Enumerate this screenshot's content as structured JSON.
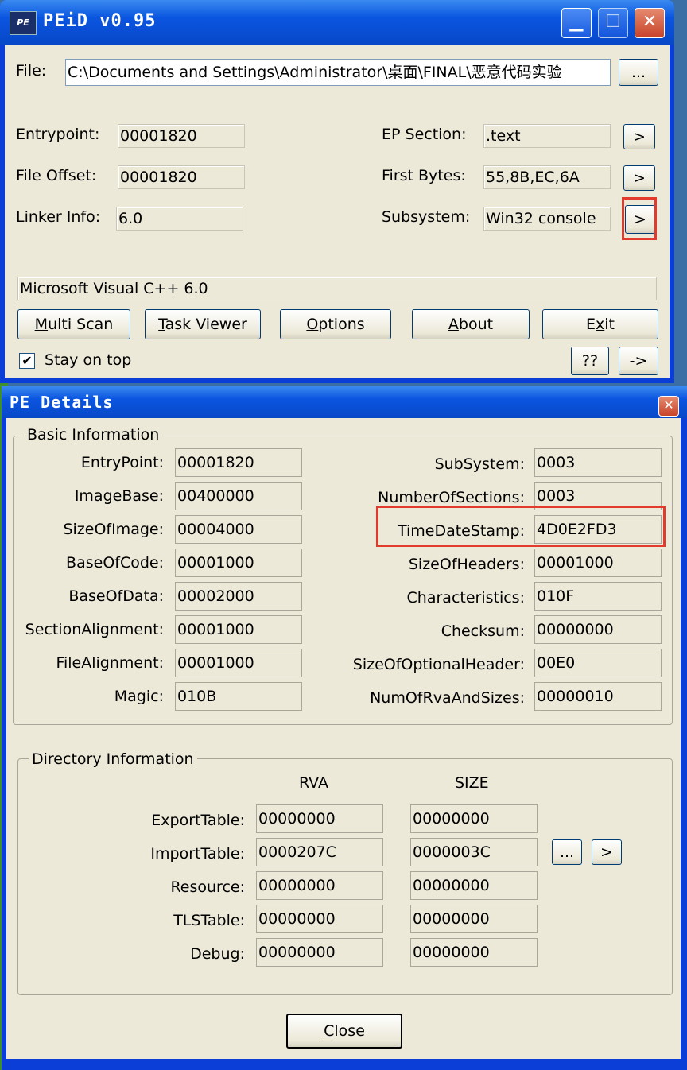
{
  "main": {
    "title": "PEiD v0.95",
    "icon_text": "PE",
    "file_label": "File:",
    "file_value": "C:\\Documents and Settings\\Administrator\\桌面\\FINAL\\恶意代码实验",
    "browse_label": "...",
    "entrypoint_label": "Entrypoint:",
    "entrypoint_value": "00001820",
    "fileoffset_label": "File Offset:",
    "fileoffset_value": "00001820",
    "linker_label": "Linker Info:",
    "linker_value": "6.0",
    "epsection_label": "EP Section:",
    "epsection_value": ".text",
    "firstbytes_label": "First Bytes:",
    "firstbytes_value": "55,8B,EC,6A",
    "subsystem_label": "Subsystem:",
    "subsystem_value": "Win32 console",
    "arrow_label": ">",
    "result": "Microsoft Visual C++ 6.0",
    "buttons": {
      "multiscan_u": "M",
      "multiscan_rest": "ulti Scan",
      "taskviewer_u": "T",
      "taskviewer_rest": "ask Viewer",
      "options_u": "O",
      "options_rest": "ptions",
      "about_u": "A",
      "about_rest": "bout",
      "exit_pre": "E",
      "exit_u": "x",
      "exit_rest": "it"
    },
    "stay_u": "S",
    "stay_rest": "tay on top",
    "help_label": "??",
    "more_label": "->"
  },
  "details": {
    "title": "PE Details",
    "basic_title": "Basic Information",
    "left": [
      {
        "label": "EntryPoint:",
        "value": "00001820"
      },
      {
        "label": "ImageBase:",
        "value": "00400000"
      },
      {
        "label": "SizeOfImage:",
        "value": "00004000"
      },
      {
        "label": "BaseOfCode:",
        "value": "00001000"
      },
      {
        "label": "BaseOfData:",
        "value": "00002000"
      },
      {
        "label": "SectionAlignment:",
        "value": "00001000"
      },
      {
        "label": "FileAlignment:",
        "value": "00001000"
      },
      {
        "label": "Magic:",
        "value": "010B"
      }
    ],
    "right": [
      {
        "label": "SubSystem:",
        "value": "0003"
      },
      {
        "label": "NumberOfSections:",
        "value": "0003"
      },
      {
        "label": "TimeDateStamp:",
        "value": "4D0E2FD3"
      },
      {
        "label": "SizeOfHeaders:",
        "value": "00001000"
      },
      {
        "label": "Characteristics:",
        "value": "010F"
      },
      {
        "label": "Checksum:",
        "value": "00000000"
      },
      {
        "label": "SizeOfOptionalHeader:",
        "value": "00E0"
      },
      {
        "label": "NumOfRvaAndSizes:",
        "value": "00000010"
      }
    ],
    "dir_title": "Directory Information",
    "rva_header": "RVA",
    "size_header": "SIZE",
    "dirs": [
      {
        "label": "ExportTable:",
        "rva": "00000000",
        "size": "00000000"
      },
      {
        "label": "ImportTable:",
        "rva": "0000207C",
        "size": "0000003C"
      },
      {
        "label": "Resource:",
        "rva": "00000000",
        "size": "00000000"
      },
      {
        "label": "TLSTable:",
        "rva": "00000000",
        "size": "00000000"
      },
      {
        "label": "Debug:",
        "rva": "00000000",
        "size": "00000000"
      }
    ],
    "dots_label": "...",
    "arrow_label": ">",
    "close_u": "C",
    "close_rest": "lose"
  },
  "colors": {
    "highlight": "#e23b2e",
    "titlebar": "#0a55e0",
    "face": "#ece9d8"
  }
}
